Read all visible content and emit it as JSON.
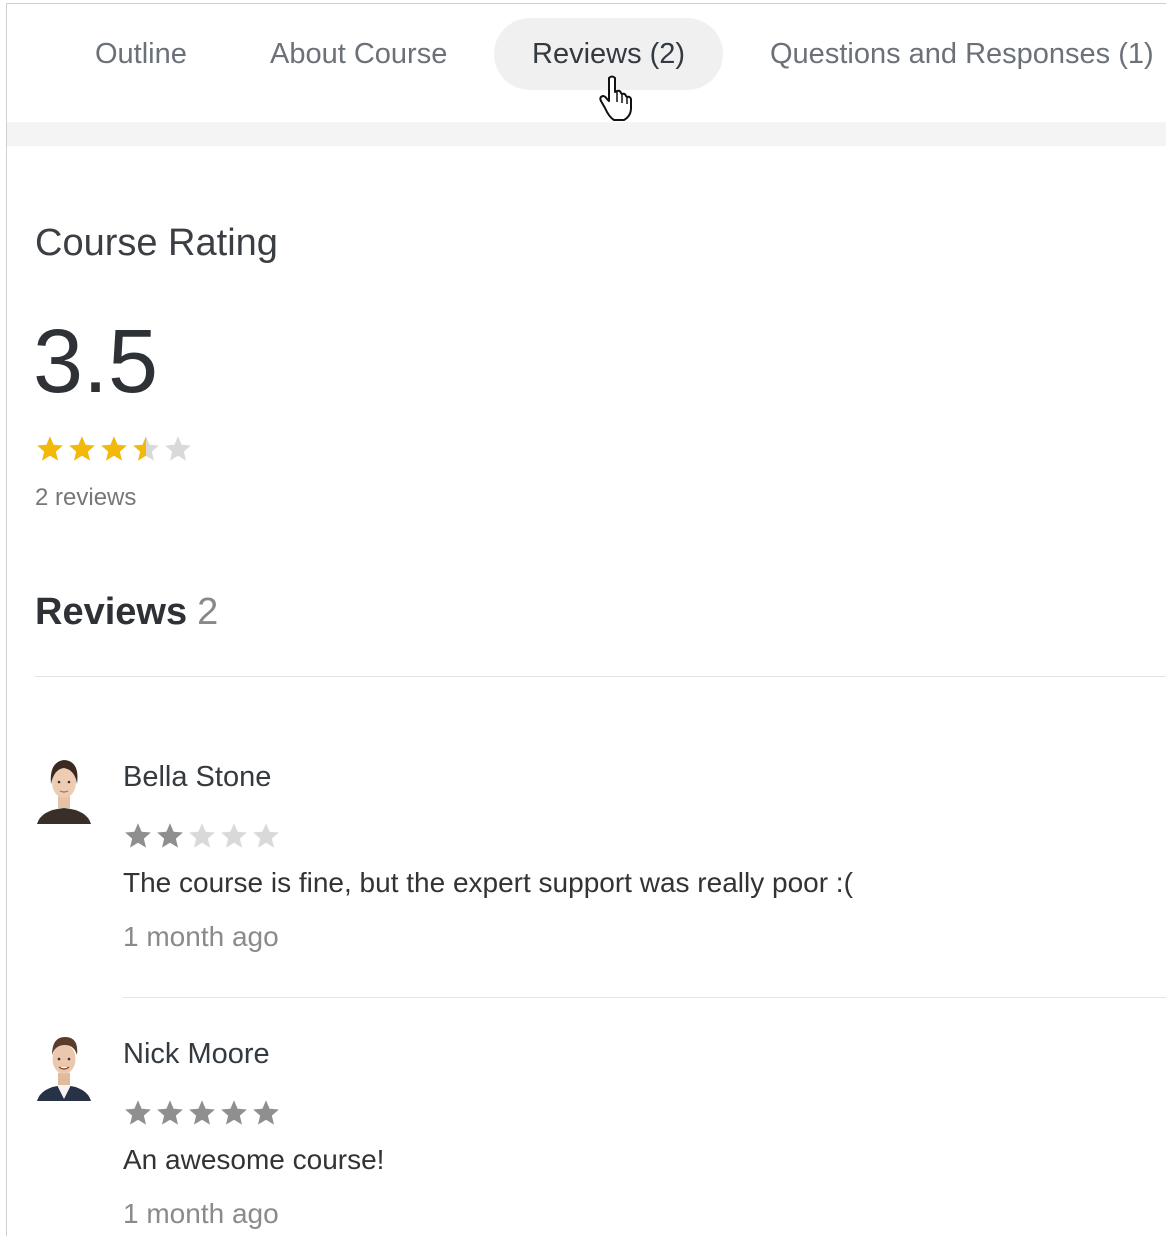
{
  "tabs": [
    {
      "label": "Outline",
      "active": false
    },
    {
      "label": "About Course",
      "active": false
    },
    {
      "label": "Reviews (2)",
      "active": true
    },
    {
      "label": "Questions and Responses (1)",
      "active": false
    }
  ],
  "rating": {
    "title": "Course Rating",
    "score": "3.5",
    "stars": 3.5,
    "count_label": "2 reviews",
    "star_color": "#f2b90d",
    "empty_star_color": "#d9d9d9"
  },
  "reviews_section": {
    "heading": "Reviews",
    "count": "2"
  },
  "reviews": [
    {
      "name": "Bella Stone",
      "stars": 2,
      "text": "The course is fine, but the expert support was really poor :(",
      "time": "1 month ago"
    },
    {
      "name": "Nick Moore",
      "stars": 5,
      "text": "An awesome course!",
      "time": "1 month ago"
    }
  ],
  "review_star_color": "#8f8f8f",
  "review_empty_star_color": "#d9d9d9",
  "icons": {
    "cursor": "hand-pointer-icon",
    "star": "star-icon"
  }
}
